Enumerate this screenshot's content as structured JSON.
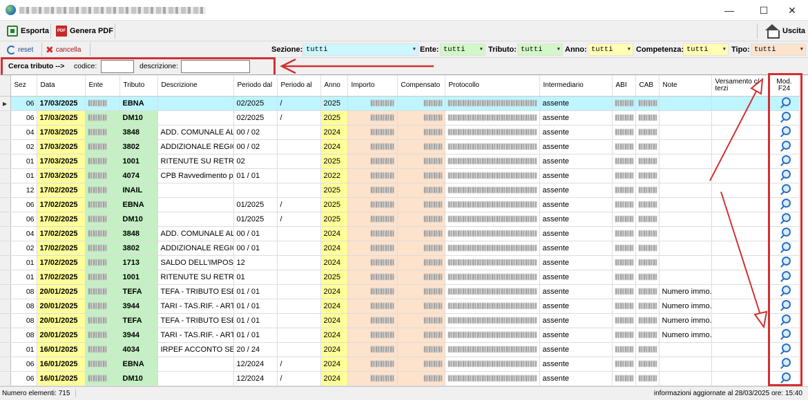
{
  "toolbar": {
    "export_label": "Esporta",
    "pdf_label": "Genera PDF",
    "pdf_icon_text": "PDF",
    "exit_label": "Uscita"
  },
  "window_buttons": {
    "minimize": "—",
    "maximize": "☐",
    "close": "✕"
  },
  "filters": {
    "reset_label": "reset",
    "delete_label": "cancella",
    "sezione_label": "Sezione:",
    "sezione_value": "tutti",
    "ente_label": "Ente:",
    "ente_value": "tutti",
    "tributo_label": "Tributo:",
    "tributo_value": "tutti",
    "anno_label": "Anno:",
    "anno_value": "tutti",
    "competenza_label": "Competenza:",
    "competenza_value": "tutti",
    "tipo_label": "Tipo:",
    "tipo_value": "tutti",
    "colors": {
      "sezione": "#ccf7ff",
      "ente": "#d2f7c8",
      "tributo": "#d2f7c8",
      "anno": "#ffffb3",
      "competenza": "#ffffb3",
      "tipo": "#fde2cc"
    }
  },
  "search": {
    "title": "Cerca tributo -->",
    "codice_label": "codice:",
    "descrizione_label": "descrizione:"
  },
  "table": {
    "columns": [
      "Sez",
      "Data",
      "Ente",
      "Tributo",
      "Descrizione",
      "Periodo dal",
      "Periodo al",
      "Anno",
      "Importo",
      "Compensato",
      "Protocollo",
      "Intermediario",
      "ABI",
      "CAB",
      "Note",
      "Versamento c/ terzi",
      "Mod. F24"
    ],
    "rows": [
      {
        "sez": "06",
        "data": "17/03/2025",
        "tributo": "EBNA",
        "descr": "",
        "dal": "02/2025",
        "al": "/",
        "anno": "2025",
        "intermediario": "assente",
        "note": ""
      },
      {
        "sez": "06",
        "data": "17/03/2025",
        "tributo": "DM10",
        "descr": "",
        "dal": "02/2025",
        "al": "/",
        "anno": "2025",
        "intermediario": "assente",
        "note": ""
      },
      {
        "sez": "04",
        "data": "17/03/2025",
        "tributo": "3848",
        "descr": "ADD. COMUNALE ALL'...",
        "dal": "00 / 02",
        "al": "",
        "anno": "2024",
        "intermediario": "assente",
        "note": ""
      },
      {
        "sez": "02",
        "data": "17/03/2025",
        "tributo": "3802",
        "descr": "ADDIZIONALE REGIO...",
        "dal": "00 / 02",
        "al": "",
        "anno": "2024",
        "intermediario": "assente",
        "note": ""
      },
      {
        "sez": "01",
        "data": "17/03/2025",
        "tributo": "1001",
        "descr": "RITENUTE SU RETRI...",
        "dal": "02",
        "al": "",
        "anno": "2025",
        "intermediario": "assente",
        "note": ""
      },
      {
        "sez": "01",
        "data": "17/03/2025",
        "tributo": "4074",
        "descr": "CPB Ravvedimento per...",
        "dal": "01 / 01",
        "al": "",
        "anno": "2022",
        "intermediario": "assente",
        "note": ""
      },
      {
        "sez": "12",
        "data": "17/02/2025",
        "tributo": "INAIL",
        "descr": "",
        "dal": "",
        "al": "",
        "anno": "2025",
        "intermediario": "assente",
        "note": ""
      },
      {
        "sez": "06",
        "data": "17/02/2025",
        "tributo": "EBNA",
        "descr": "",
        "dal": "01/2025",
        "al": "/",
        "anno": "2025",
        "intermediario": "assente",
        "note": ""
      },
      {
        "sez": "06",
        "data": "17/02/2025",
        "tributo": "DM10",
        "descr": "",
        "dal": "01/2025",
        "al": "/",
        "anno": "2025",
        "intermediario": "assente",
        "note": ""
      },
      {
        "sez": "04",
        "data": "17/02/2025",
        "tributo": "3848",
        "descr": "ADD. COMUNALE ALL'...",
        "dal": "00 / 01",
        "al": "",
        "anno": "2024",
        "intermediario": "assente",
        "note": ""
      },
      {
        "sez": "02",
        "data": "17/02/2025",
        "tributo": "3802",
        "descr": "ADDIZIONALE REGIO...",
        "dal": "00 / 01",
        "al": "",
        "anno": "2024",
        "intermediario": "assente",
        "note": ""
      },
      {
        "sez": "01",
        "data": "17/02/2025",
        "tributo": "1713",
        "descr": "SALDO DELL'IMPOST...",
        "dal": "12",
        "al": "",
        "anno": "2024",
        "intermediario": "assente",
        "note": ""
      },
      {
        "sez": "01",
        "data": "17/02/2025",
        "tributo": "1001",
        "descr": "RITENUTE SU RETRI...",
        "dal": "01",
        "al": "",
        "anno": "2025",
        "intermediario": "assente",
        "note": ""
      },
      {
        "sez": "08",
        "data": "20/01/2025",
        "tributo": "TEFA",
        "descr": "TEFA - TRIBUTO ESE...",
        "dal": "01 / 01",
        "al": "",
        "anno": "2024",
        "intermediario": "assente",
        "note": "Numero immo..."
      },
      {
        "sez": "08",
        "data": "20/01/2025",
        "tributo": "3944",
        "descr": "TARI - TAS.RIF. - ART...",
        "dal": "01 / 01",
        "al": "",
        "anno": "2024",
        "intermediario": "assente",
        "note": "Numero immo..."
      },
      {
        "sez": "08",
        "data": "20/01/2025",
        "tributo": "TEFA",
        "descr": "TEFA - TRIBUTO ESE...",
        "dal": "01 / 01",
        "al": "",
        "anno": "2024",
        "intermediario": "assente",
        "note": "Numero immo..."
      },
      {
        "sez": "08",
        "data": "20/01/2025",
        "tributo": "3944",
        "descr": "TARI - TAS.RIF. - ART...",
        "dal": "01 / 01",
        "al": "",
        "anno": "2024",
        "intermediario": "assente",
        "note": "Numero immo..."
      },
      {
        "sez": "01",
        "data": "16/01/2025",
        "tributo": "4034",
        "descr": "IRPEF ACCONTO  SEC...",
        "dal": "20 / 24",
        "al": "",
        "anno": "2024",
        "intermediario": "assente",
        "note": ""
      },
      {
        "sez": "06",
        "data": "16/01/2025",
        "tributo": "EBNA",
        "descr": "",
        "dal": "12/2024",
        "al": "/",
        "anno": "2024",
        "intermediario": "assente",
        "note": ""
      },
      {
        "sez": "06",
        "data": "16/01/2025",
        "tributo": "DM10",
        "descr": "",
        "dal": "12/2024",
        "al": "/",
        "anno": "2024",
        "intermediario": "assente",
        "note": ""
      }
    ]
  },
  "status": {
    "count_text": "Numero elementi: 715",
    "updated_text": "informazioni aggiornate al 28/03/2025  ore: 15:40"
  }
}
